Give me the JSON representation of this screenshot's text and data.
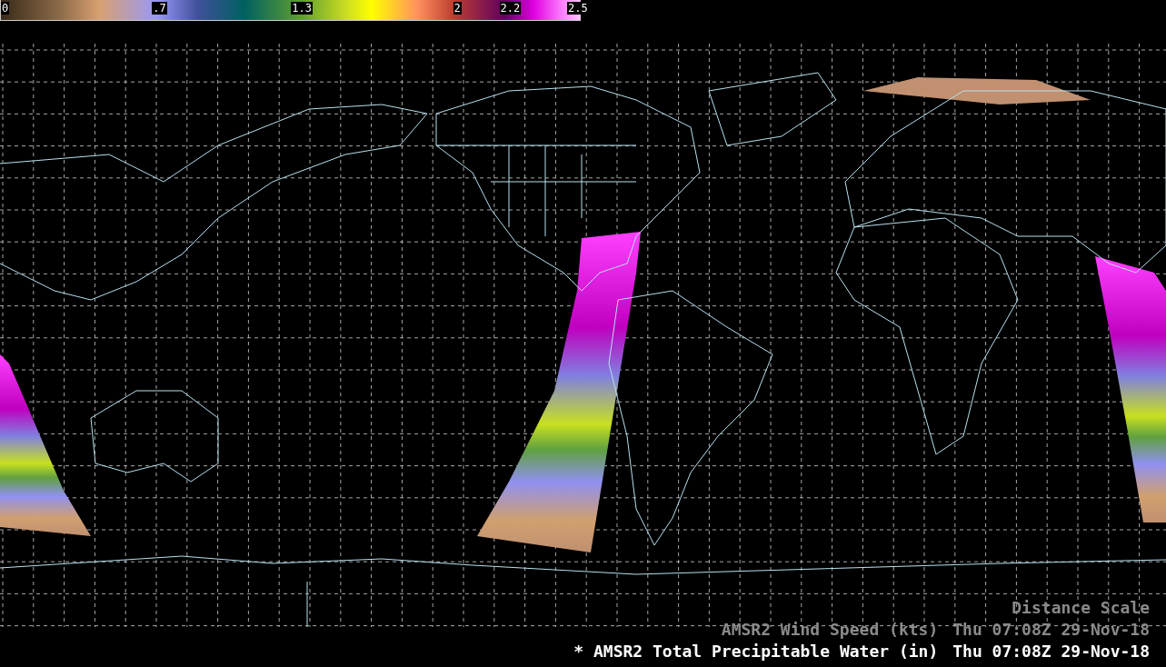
{
  "colorbar": {
    "labels": [
      ".7",
      "1.3",
      "2",
      "2.2",
      "2.5"
    ],
    "start_label": "0"
  },
  "legend": {
    "title": "Distance Scale",
    "layers": [
      {
        "name": "AMSR2 Wind Speed (kts)",
        "time": "Thu 07:08Z 29-Nov-18",
        "active": false
      },
      {
        "prefix": "*",
        "name": "AMSR2 Total Precipitable Water (in)",
        "time": "Thu 07:08Z 29-Nov-18",
        "active": true
      }
    ]
  }
}
